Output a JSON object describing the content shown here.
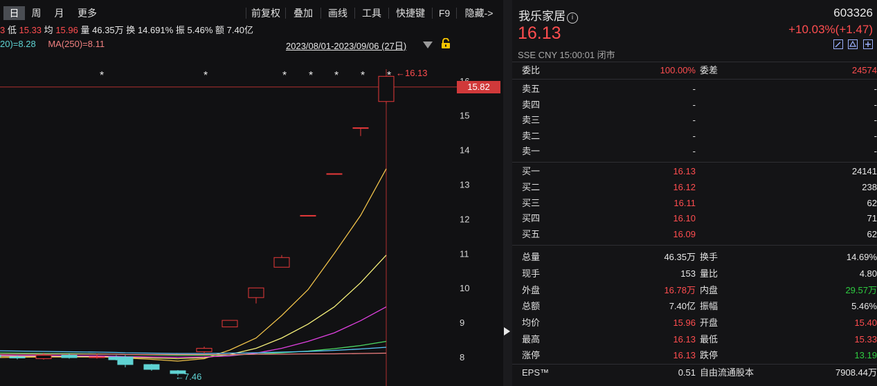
{
  "toolbar": {
    "periods": [
      {
        "label": "日",
        "active": true
      },
      {
        "label": "周",
        "active": false
      },
      {
        "label": "月",
        "active": false
      },
      {
        "label": "更多",
        "active": false
      }
    ],
    "tools": [
      "前复权",
      "叠加",
      "画线",
      "工具",
      "快捷键",
      "F9",
      "隐藏->"
    ]
  },
  "info_line": {
    "lead": "3",
    "low_label": "低",
    "low_value": "15.33",
    "avg_label": "均",
    "avg_value": "15.96",
    "vol_label": "量",
    "vol_value": "46.35万",
    "turnover_label": "换",
    "turnover_value": "14.691%",
    "amplitude_label": "振",
    "amplitude_value": "5.46%",
    "amount_label": "额",
    "amount_value": "7.40亿"
  },
  "ma_line": {
    "ma120": "20)=8.28",
    "ma250": "MA(250)=8.11"
  },
  "chart_range": "2023/08/01-2023/09/06 (27日)",
  "chart_data": {
    "type": "candlestick",
    "y_ticks": [
      8,
      9,
      10,
      11,
      12,
      13,
      14,
      15,
      16
    ],
    "ylim": [
      7.2,
      16.8
    ],
    "crosshair_price": "15.82",
    "high_marker": "16.13",
    "low_marker": "7.46",
    "star_markers": [
      "*",
      "*",
      "*",
      "*",
      "*",
      "*",
      "*"
    ],
    "candles": [
      {
        "open": 8.05,
        "close": 8.0,
        "high": 8.1,
        "low": 7.97
      },
      {
        "open": 8.0,
        "close": 7.97,
        "high": 8.05,
        "low": 7.93
      },
      {
        "open": 7.95,
        "close": 8.05,
        "high": 8.12,
        "low": 7.92
      },
      {
        "open": 8.05,
        "close": 7.98,
        "high": 8.1,
        "low": 7.95
      },
      {
        "open": 7.98,
        "close": 8.0,
        "high": 8.1,
        "low": 7.95
      },
      {
        "open": 8.0,
        "close": 7.92,
        "high": 8.05,
        "low": 7.9
      },
      {
        "open": 8.0,
        "close": 7.78,
        "high": 8.05,
        "low": 7.7
      },
      {
        "open": 7.78,
        "close": 7.64,
        "high": 7.8,
        "low": 7.6
      },
      {
        "open": 7.6,
        "close": 7.52,
        "high": 7.62,
        "low": 7.46
      },
      {
        "open": 8.15,
        "close": 8.25,
        "high": 8.3,
        "low": 8.1
      },
      {
        "open": 8.87,
        "close": 9.06,
        "high": 9.06,
        "low": 8.87
      },
      {
        "open": 9.72,
        "close": 10.0,
        "high": 10.0,
        "low": 9.55
      },
      {
        "open": 10.6,
        "close": 10.88,
        "high": 10.95,
        "low": 10.6
      },
      {
        "open": 12.1,
        "close": 12.1,
        "high": 12.1,
        "low": 12.1
      },
      {
        "open": 13.31,
        "close": 13.31,
        "high": 13.31,
        "low": 13.31
      },
      {
        "open": 14.64,
        "close": 14.64,
        "high": 14.64,
        "low": 14.4
      },
      {
        "open": 15.4,
        "close": 16.13,
        "high": 16.13,
        "low": 15.33
      }
    ],
    "ma_series": [
      {
        "color": "#f0c24a",
        "values": [
          7.98,
          7.99,
          8.0,
          8.0,
          8.0,
          7.99,
          7.97,
          7.93,
          7.88,
          7.95,
          8.2,
          8.55,
          9.2,
          9.95,
          11.0,
          12.1,
          13.45
        ]
      },
      {
        "color": "#f5f07a",
        "values": [
          8.02,
          8.02,
          8.02,
          8.01,
          8.01,
          8.0,
          7.99,
          7.97,
          7.95,
          7.98,
          8.07,
          8.25,
          8.55,
          8.95,
          9.45,
          10.15,
          10.95
        ]
      },
      {
        "color": "#e040e0",
        "values": [
          8.05,
          8.04,
          8.04,
          8.03,
          8.03,
          8.02,
          8.01,
          8.0,
          7.99,
          8.0,
          8.03,
          8.11,
          8.25,
          8.45,
          8.7,
          9.05,
          9.45
        ]
      },
      {
        "color": "#4cd964",
        "values": [
          8.12,
          8.11,
          8.1,
          8.1,
          8.09,
          8.08,
          8.07,
          8.06,
          8.05,
          8.05,
          8.06,
          8.08,
          8.12,
          8.17,
          8.24,
          8.33,
          8.45
        ]
      },
      {
        "color": "#5cc8ff",
        "values": [
          8.18,
          8.17,
          8.16,
          8.15,
          8.14,
          8.13,
          8.12,
          8.11,
          8.1,
          8.1,
          8.11,
          8.12,
          8.14,
          8.16,
          8.19,
          8.23,
          8.28
        ]
      },
      {
        "color": "#f08080",
        "values": [
          8.08,
          8.08,
          8.08,
          8.08,
          8.08,
          8.08,
          8.07,
          8.07,
          8.07,
          8.07,
          8.07,
          8.08,
          8.08,
          8.09,
          8.09,
          8.1,
          8.11
        ]
      }
    ]
  },
  "colors": {
    "up": "#e8393a",
    "down": "#5fd3d3",
    "ma120": "#5fd3d3",
    "ma250": "#f08080",
    "accent_red": "#ff4d4f",
    "accent_green": "#2ecc40"
  },
  "quote": {
    "name": "我乐家居",
    "code": "603326",
    "price": "16.13",
    "change": "+10.03%(+1.47)",
    "exchange_line": "SSE  CNY  15:00:01  闭市",
    "info_icon": "info-icon",
    "tool_icons": [
      "edit-icon",
      "alert-icon",
      "add-icon"
    ],
    "weibi": {
      "label": "委比",
      "value": "100.00%",
      "label2": "委差",
      "value2": "24574"
    },
    "sell": [
      {
        "label": "卖五",
        "price": "-",
        "vol": "-"
      },
      {
        "label": "卖四",
        "price": "-",
        "vol": "-"
      },
      {
        "label": "卖三",
        "price": "-",
        "vol": "-"
      },
      {
        "label": "卖二",
        "price": "-",
        "vol": "-"
      },
      {
        "label": "卖一",
        "price": "-",
        "vol": "-"
      }
    ],
    "buy": [
      {
        "label": "买一",
        "price": "16.13",
        "vol": "24141"
      },
      {
        "label": "买二",
        "price": "16.12",
        "vol": "238"
      },
      {
        "label": "买三",
        "price": "16.11",
        "vol": "62"
      },
      {
        "label": "买四",
        "price": "16.10",
        "vol": "71"
      },
      {
        "label": "买五",
        "price": "16.09",
        "vol": "62"
      }
    ],
    "stats": [
      {
        "l1": "总量",
        "v1": "46.35万",
        "c1": "white",
        "l2": "换手",
        "v2": "14.69%",
        "c2": "white"
      },
      {
        "l1": "现手",
        "v1": "153",
        "c1": "white",
        "l2": "量比",
        "v2": "4.80",
        "c2": "white"
      },
      {
        "l1": "外盘",
        "v1": "16.78万",
        "c1": "red",
        "l2": "内盘",
        "v2": "29.57万",
        "c2": "green"
      },
      {
        "l1": "总额",
        "v1": "7.40亿",
        "c1": "white",
        "l2": "振幅",
        "v2": "5.46%",
        "c2": "white"
      },
      {
        "l1": "均价",
        "v1": "15.96",
        "c1": "red",
        "l2": "开盘",
        "v2": "15.40",
        "c2": "red"
      },
      {
        "l1": "最高",
        "v1": "16.13",
        "c1": "red",
        "l2": "最低",
        "v2": "15.33",
        "c2": "red"
      },
      {
        "l1": "涨停",
        "v1": "16.13",
        "c1": "red",
        "l2": "跌停",
        "v2": "13.19",
        "c2": "green"
      },
      {
        "l1": "EPS™",
        "v1": "0.51",
        "c1": "white",
        "l2": "自由流通股本",
        "v2": "7908.44万",
        "c2": "white"
      }
    ]
  }
}
